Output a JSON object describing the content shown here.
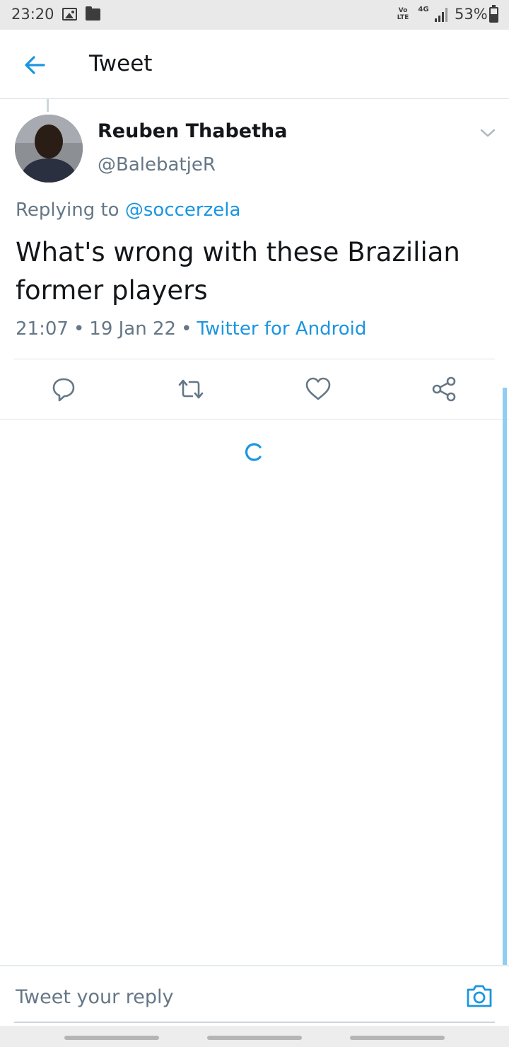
{
  "status_bar": {
    "time": "23:20",
    "volte": "Vo LTE",
    "network": "4G",
    "battery": "53%"
  },
  "header": {
    "title": "Tweet"
  },
  "tweet": {
    "author_name": "Reuben Thabetha",
    "author_handle": "@BalebatjeR",
    "replying_prefix": "Replying to",
    "replying_to": "@soccerzela",
    "text": "What's wrong with these Brazilian former players",
    "time": "21:07",
    "date": "19 Jan 22",
    "source": "Twitter for Android",
    "separator": "•"
  },
  "actions": {
    "reply": "reply-icon",
    "retweet": "retweet-icon",
    "like": "heart-icon",
    "share": "share-icon"
  },
  "reply_bar": {
    "placeholder": "Tweet your reply"
  },
  "colors": {
    "accent": "#1b95e0",
    "secondary_text": "#657786",
    "primary_text": "#14171a"
  }
}
